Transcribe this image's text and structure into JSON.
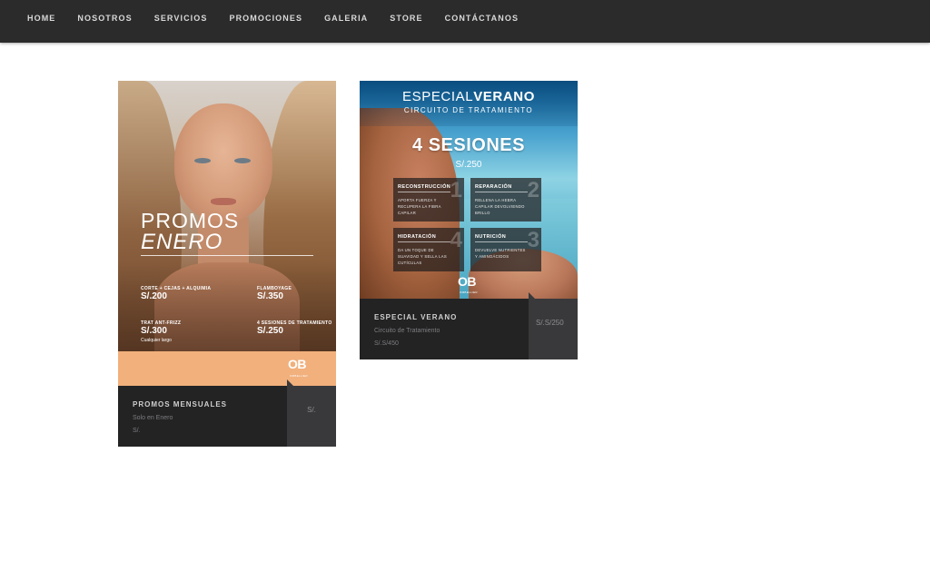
{
  "nav": {
    "items": [
      "HOME",
      "NOSOTROS",
      "SERVICIOS",
      "PROMOCIONES",
      "GALERIA",
      "STORE",
      "CONTÁCTANOS"
    ]
  },
  "cards": [
    {
      "title": "PROMOS MENSUALES",
      "subtitle": "Solo en Enero",
      "price": "S/.",
      "price_badge": "S/.",
      "poster": {
        "title_line1": "PROMOS",
        "title_line2": "ENERO",
        "offers": [
          {
            "label": "CORTE + CEJAS + ALQUIMIA",
            "price": "S/.200"
          },
          {
            "label": "FLAMBOYAGE",
            "price": "S/.350"
          },
          {
            "label": "TRAT ANT-FRIZZ",
            "price": "S/.300",
            "note": "Cualquier largo"
          },
          {
            "label": "4 SESIONES DE TRATAMIENTO",
            "price": "S/.250"
          }
        ],
        "logo": "OB",
        "logo_sub": "OMBELLIER"
      }
    },
    {
      "title": "ESPECIAL VERANO",
      "subtitle": "Circuito de Tratamiento",
      "price": "S/.S/450",
      "price_badge": "S/.S/250",
      "poster": {
        "title_light": "ESPECIAL",
        "title_bold": "VERANO",
        "subtitle": "CIRCUITO DE TRATAMIENTO",
        "sessions": "4 SESIONES",
        "sessions_price": "S/.250",
        "treatments": [
          {
            "num": "1",
            "name": "RECONSTRUCCIÓN",
            "desc": "APORTA FUERZA Y RECUPERA LA FIBRA CAPILAR"
          },
          {
            "num": "2",
            "name": "REPARACIÓN",
            "desc": "RELLENA LA HEBRA CAPILAR DEVOLVIENDO BRILLO"
          },
          {
            "num": "4",
            "name": "HIDRATACIÓN",
            "desc": "DA UN TOQUE DE SUAVIDAD Y SELLA LAS CUTÍCULAS"
          },
          {
            "num": "3",
            "name": "NUTRICIÓN",
            "desc": "DEVUELVE NUTRIENTES Y AMINOÁCIDOS"
          }
        ],
        "logo": "OB",
        "logo_sub": "OMBELLIER"
      }
    }
  ]
}
